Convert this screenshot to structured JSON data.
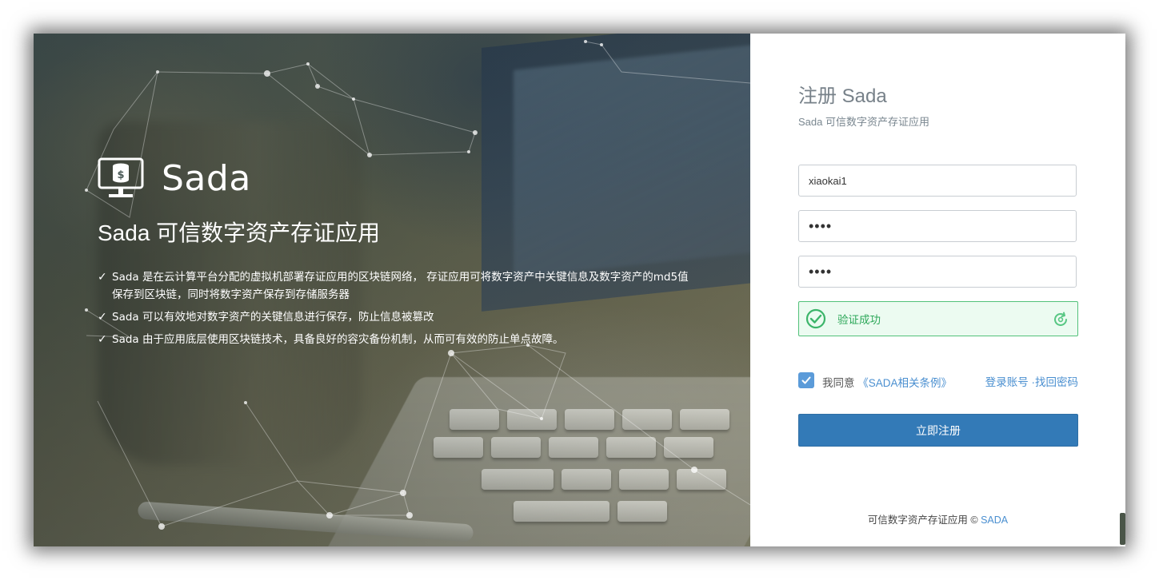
{
  "hero": {
    "brand_name": "Sada",
    "title": "Sada 可信数字资产存证应用",
    "features": [
      "Sada 是在云计算平台分配的虚拟机部署存证应用的区块链网络， 存证应用可将数字资产中关键信息及数字资产的md5值保存到区块链，同时将数字资产保存到存储服务器",
      "Sada 可以有效地对数字资产的关键信息进行保存，防止信息被篡改",
      "Sada 由于应用底层使用区块链技术，具备良好的容灾备份机制，从而可有效的防止单点故障。"
    ]
  },
  "form": {
    "title": "注册 Sada",
    "subtitle": "Sada 可信数字资产存证应用",
    "username_value": "xiaokai1",
    "password_value": "••••",
    "confirm_password_value": "••••",
    "verify_text": "验证成功",
    "agree_prefix": "我同意",
    "agree_link": "《SADA相关条例》",
    "login_link": "登录账号",
    "separator": " ·",
    "forgot_link": "找回密码",
    "submit_label": "立即注册",
    "footer_text": "可信数字资产存证应用 © ",
    "footer_brand": "SADA"
  },
  "colors": {
    "primary": "#337ab7",
    "link": "#4a8fd0",
    "success_border": "#52c17a",
    "success_bg": "#ecfbf1",
    "success_text": "#2ea85a"
  },
  "icons": {
    "logo": "monitor-database-icon",
    "feature_check": "check-icon",
    "verify": "check-circle-icon",
    "refresh": "refresh-icon",
    "checkbox": "checkbox-checked-icon"
  }
}
